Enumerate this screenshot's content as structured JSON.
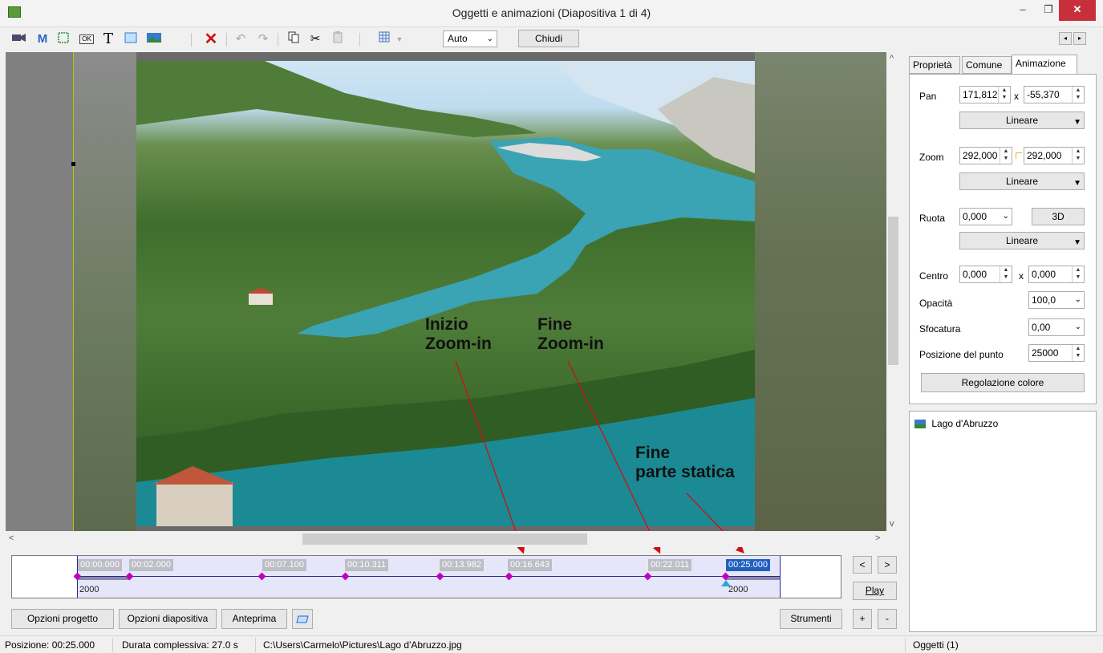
{
  "window": {
    "title": "Oggetti e animazioni  (Diapositiva 1 di 4)",
    "min": "–",
    "max": "❐",
    "close": "✕"
  },
  "toolbar": {
    "m_label": "M",
    "t_label": "T",
    "ok_label": "OK",
    "zoom_select": "Auto",
    "close_button": "Chiudi"
  },
  "annotations": {
    "start_zoom": "Inizio\nZoom-in",
    "end_zoom": "Fine\nZoom-in",
    "end_static": "Fine\nparte statica"
  },
  "timeline": {
    "labels": [
      "00:00.000",
      "00:02.000",
      "00:07.100",
      "00:10.311",
      "00:13.982",
      "00:16.643",
      "00:22.011",
      "00:25.000"
    ],
    "start_value": "2000",
    "end_value": "2000",
    "prev": "<",
    "next": ">",
    "play": "Play"
  },
  "bottom_buttons": {
    "project_options": "Opzioni progetto",
    "slide_options": "Opzioni diapositiva",
    "preview": "Anteprima",
    "tools": "Strumenti",
    "add": "+",
    "remove": "-"
  },
  "tabs": [
    "Proprietà",
    "Comune",
    "Animazione"
  ],
  "properties": {
    "pan_label": "Pan",
    "pan_x": "171,812",
    "pan_y": "-55,370",
    "pan_interp": "Lineare",
    "x_sep": "x",
    "zoom_label": "Zoom",
    "zoom_x": "292,000",
    "zoom_y": "292,000",
    "zoom_interp": "Lineare",
    "rotate_label": "Ruota",
    "rotate_value": "0,000",
    "rotate_3d": "3D",
    "rotate_interp": "Lineare",
    "center_label": "Centro",
    "center_x": "0,000",
    "center_y": "0,000",
    "opacity_label": "Opacità",
    "opacity_value": "100,0",
    "blur_label": "Sfocatura",
    "blur_value": "0,00",
    "point_pos_label": "Posizione del punto",
    "point_pos_value": "25000",
    "color_adjust": "Regolazione colore"
  },
  "objects": {
    "item": "Lago d'Abruzzo",
    "footer": "Oggetti (1)"
  },
  "status": {
    "position": "Posizione:  00:25.000",
    "duration": "Durata complessiva:  27.0 s",
    "path": "C:\\Users\\Carmelo\\Pictures\\Lago d'Abruzzo.jpg"
  },
  "colors": {
    "accent": "#1e5fbf",
    "keyframe": "#c000c0",
    "close_button": "#c7303a",
    "annotation_arrow": "#d01010"
  }
}
